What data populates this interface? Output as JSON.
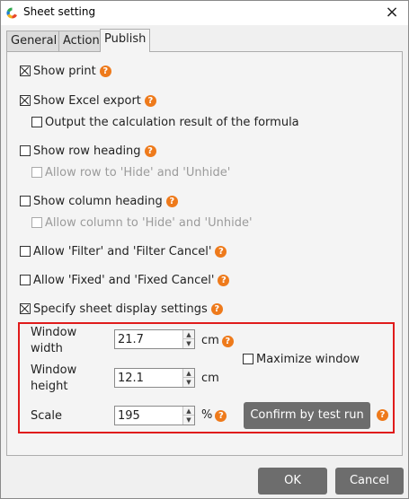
{
  "window": {
    "title": "Sheet setting",
    "close_icon": "×"
  },
  "tabs": [
    {
      "label": "General",
      "active": false
    },
    {
      "label": "Action",
      "active": false
    },
    {
      "label": "Publish",
      "active": true
    }
  ],
  "options": {
    "show_print": {
      "label": "Show print",
      "checked": true
    },
    "show_excel_export": {
      "label": "Show Excel export",
      "checked": true
    },
    "output_calc_result": {
      "label": "Output the calculation result of the formula",
      "checked": false
    },
    "show_row_heading": {
      "label": "Show row heading",
      "checked": false
    },
    "allow_row_hide": {
      "label": "Allow row to 'Hide' and 'Unhide'",
      "checked": false,
      "disabled": true
    },
    "show_column_heading": {
      "label": "Show column heading",
      "checked": false
    },
    "allow_column_hide": {
      "label": "Allow column to 'Hide' and 'Unhide'",
      "checked": false,
      "disabled": true
    },
    "allow_filter": {
      "label": "Allow 'Filter' and 'Filter Cancel'",
      "checked": false
    },
    "allow_fixed": {
      "label": "Allow 'Fixed' and 'Fixed Cancel'",
      "checked": false
    },
    "specify_display": {
      "label": "Specify sheet display settings",
      "checked": true
    }
  },
  "display_settings": {
    "width_label_line1": "Window",
    "width_label_line2": "width",
    "width_value": "21.7",
    "width_unit": "cm",
    "height_label_line1": "Window",
    "height_label_line2": "height",
    "height_value": "12.1",
    "height_unit": "cm",
    "scale_label": "Scale",
    "scale_value": "195",
    "scale_unit": "%",
    "maximize_label": "Maximize window",
    "maximize_checked": false,
    "test_run_label": "Confirm by test run"
  },
  "footer": {
    "ok_label": "OK",
    "cancel_label": "Cancel"
  },
  "icons": {
    "help": "help-icon",
    "spin_up": "▲",
    "spin_down": "▼"
  },
  "colors": {
    "help_icon": "#ee7a1b",
    "highlight_border": "#e01b1b",
    "button_bg": "#6d6d6d"
  }
}
